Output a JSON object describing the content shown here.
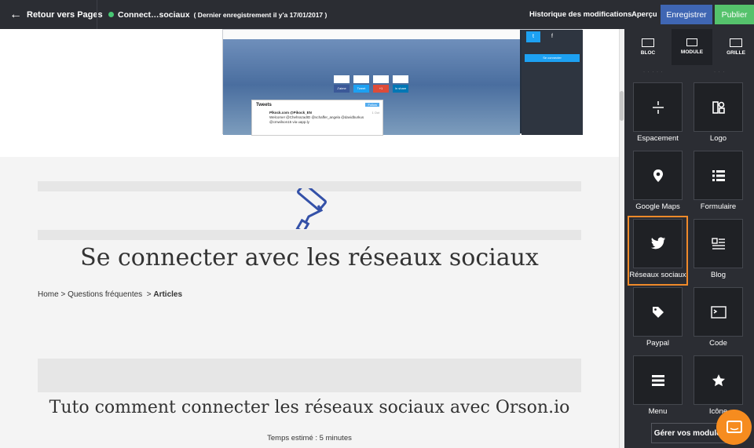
{
  "topbar": {
    "back_label": "Retour vers Pages",
    "page_name": "Connect…sociaux",
    "saved_note": "( Dernier enregistrement il y'a 17/01/2017 )",
    "history_label": "Historique des modifications",
    "preview_label": "Aperçu",
    "save_label": "Enregistrer",
    "publish_label": "Publier",
    "colors": {
      "save": "#3f66b3",
      "publish": "#55c26c",
      "status_dot": "#48c774"
    }
  },
  "preview": {
    "share_buttons": [
      "J'aime",
      "Tweet",
      "+1",
      "In share"
    ],
    "tweets_title": "Tweets",
    "follow_label": "Follow",
    "tweet_author": "Plkock.com @Pikock_EN",
    "tweet_text": "Welcome! @ChehrazadID @schaffer_angela @davidburkus @cmwilson15 via uapp.ly",
    "tweet_date": "1 Oct",
    "side_connect": "Se connecter"
  },
  "article": {
    "title": "Se connecter avec les réseaux sociaux",
    "breadcrumb": [
      "Home",
      ">",
      "Questions fréquentes",
      ">"
    ],
    "breadcrumb_current": "Articles",
    "subtitle": "Tuto comment connecter les réseaux sociaux avec Orson.io",
    "estimate": "Temps estimé : 5 minutes"
  },
  "panel": {
    "tabs": [
      "BLOC",
      "MODULE",
      "GRILLE"
    ],
    "selected_tab": "MODULE",
    "modules": [
      {
        "label": "Espacement",
        "icon": "spacing-icon"
      },
      {
        "label": "Logo",
        "icon": "logo-icon"
      },
      {
        "label": "Google Maps",
        "icon": "map-pin-icon"
      },
      {
        "label": "Formulaire",
        "icon": "form-list-icon"
      },
      {
        "label": "Réseaux sociaux",
        "icon": "twitter-bird-icon"
      },
      {
        "label": "Blog",
        "icon": "blog-icon"
      },
      {
        "label": "Paypal",
        "icon": "tag-icon"
      },
      {
        "label": "Code",
        "icon": "terminal-icon"
      },
      {
        "label": "Menu",
        "icon": "hamburger-menu-icon"
      },
      {
        "label": "Icône",
        "icon": "star-icon"
      }
    ],
    "highlighted": "Réseaux sociaux",
    "manage_label": "Gérer vos modules",
    "highlight_color": "#f08a2a",
    "chat_color": "#f68c1f"
  }
}
